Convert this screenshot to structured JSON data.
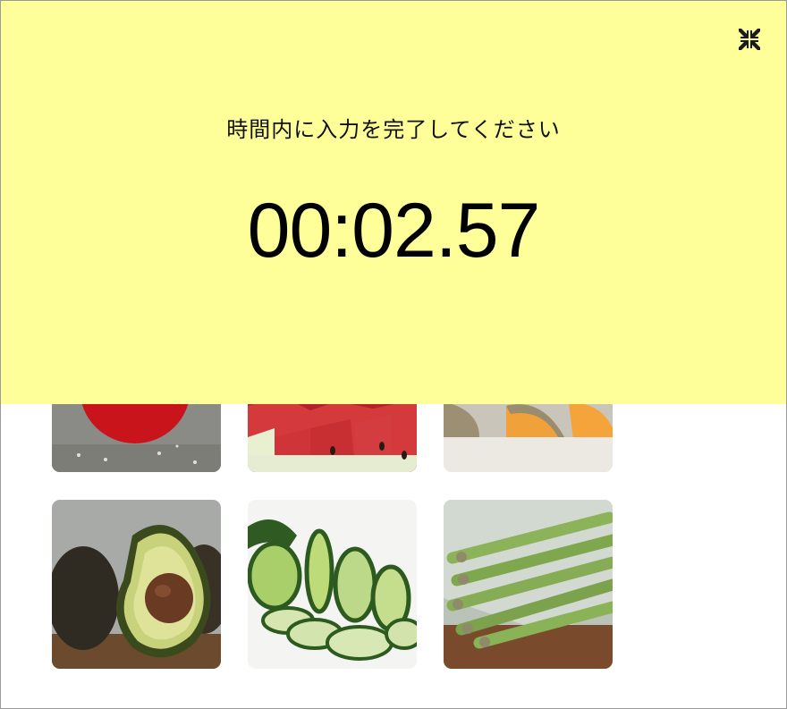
{
  "overlay": {
    "prompt": "時間内に入力を完了してください",
    "timer": "00:02.57",
    "background_color": "#ffff99",
    "fullscreen_icon": "fullscreen-exit-icon"
  },
  "tiles": [
    {
      "subject": "tomato"
    },
    {
      "subject": "watermelon"
    },
    {
      "subject": "melon"
    },
    {
      "subject": "avocado"
    },
    {
      "subject": "cucumber"
    },
    {
      "subject": "asparagus"
    }
  ]
}
